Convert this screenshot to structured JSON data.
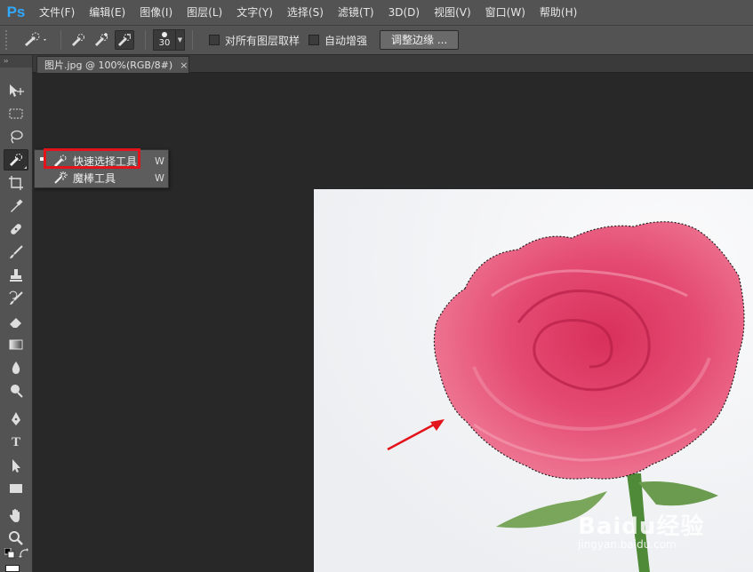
{
  "app": {
    "logo": "Ps",
    "menu": [
      "文件(F)",
      "编辑(E)",
      "图像(I)",
      "图层(L)",
      "文字(Y)",
      "选择(S)",
      "滤镜(T)",
      "3D(D)",
      "视图(V)",
      "窗口(W)",
      "帮助(H)"
    ]
  },
  "options": {
    "brush_size": "30",
    "sample_all_layers": "对所有图层取样",
    "auto_enhance": "自动增强",
    "refine_edge": "调整边缘 ..."
  },
  "toolbox": {
    "header": "››",
    "tools": [
      "move-tool",
      "marquee-tool",
      "lasso-tool",
      "quick-selection-tool",
      "crop-tool",
      "eyedropper-tool",
      "healing-brush-tool",
      "brush-tool",
      "clone-stamp-tool",
      "history-brush-tool",
      "eraser-tool",
      "gradient-tool",
      "blur-tool",
      "dodge-tool",
      "pen-tool",
      "type-tool",
      "path-selection-tool",
      "rectangle-tool",
      "hand-tool",
      "zoom-tool"
    ],
    "type_tool_glyph": "T"
  },
  "document": {
    "tab_title": "图片.jpg @ 100%(RGB/8#)",
    "close_glyph": "×"
  },
  "flyout": {
    "items": [
      {
        "name": "快速选择工具",
        "shortcut": "W"
      },
      {
        "name": "魔棒工具",
        "shortcut": "W"
      }
    ]
  },
  "watermark": {
    "brand": "Baidu经验",
    "url": "jingyan.baidu.com"
  },
  "colors": {
    "annotation_red": "#e3131b",
    "rose": "#e44a72",
    "photo_bg": "#f4f5f7"
  }
}
